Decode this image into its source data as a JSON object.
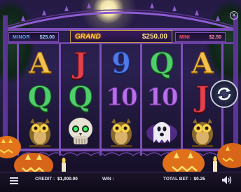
{
  "jackpots": {
    "minor": {
      "label": "MINOR",
      "value": "$25.00"
    },
    "grand": {
      "label": "GRAND",
      "value": "$250.00"
    },
    "mini": {
      "label": "MINI",
      "value": "$2.50"
    }
  },
  "reels": [
    [
      {
        "symbol": "A",
        "style": "gold"
      },
      {
        "symbol": "Q",
        "style": "green"
      },
      {
        "symbol": "owl",
        "style": "icon"
      }
    ],
    [
      {
        "symbol": "J",
        "style": "red"
      },
      {
        "symbol": "Q",
        "style": "green"
      },
      {
        "symbol": "skull",
        "style": "icon"
      }
    ],
    [
      {
        "symbol": "9",
        "style": "blue"
      },
      {
        "symbol": "10",
        "style": "purple"
      },
      {
        "symbol": "owl",
        "style": "icon"
      }
    ],
    [
      {
        "symbol": "Q",
        "style": "green"
      },
      {
        "symbol": "10",
        "style": "purple"
      },
      {
        "symbol": "ghost",
        "style": "icon"
      }
    ],
    [
      {
        "symbol": "A",
        "style": "gold"
      },
      {
        "symbol": "J",
        "style": "red"
      },
      {
        "symbol": "owl",
        "style": "icon"
      }
    ]
  ],
  "bottom_bar": {
    "credit_label": "CREDIT :",
    "credit_value": "$1,000.00",
    "win_label": "WIN :",
    "win_value": "",
    "bet_label": "TOTAL BET :",
    "bet_value": "$0.25"
  },
  "icons": {
    "menu": "menu-icon",
    "spin": "spin-arrows-icon",
    "sound": "speaker-icon",
    "close": "close-icon"
  },
  "colors": {
    "minor": "#56a6ff",
    "grand": "#ffd23c",
    "mini": "#ff4d6d",
    "frame": "#7d4fb8"
  }
}
